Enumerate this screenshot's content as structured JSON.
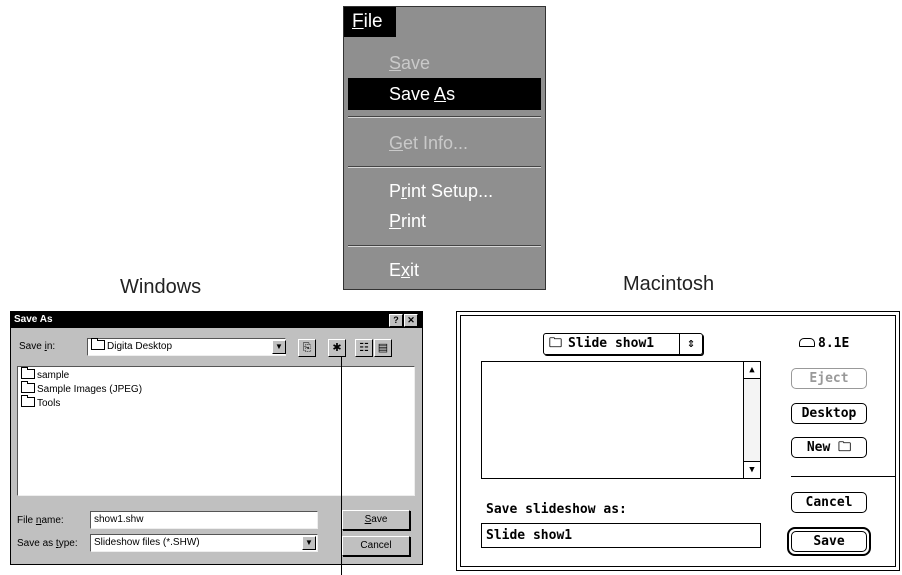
{
  "menu": {
    "title_key": "F",
    "title_rest": "ile",
    "items": [
      {
        "pre": "",
        "key": "S",
        "post": "ave",
        "disabled": true
      },
      {
        "pre": "Save ",
        "key": "A",
        "post": "s",
        "selected": true
      },
      {
        "pre": "",
        "key": "G",
        "post": "et Info...",
        "disabled": true
      },
      {
        "pre": "P",
        "key": "r",
        "post": "int Setup..."
      },
      {
        "pre": "",
        "key": "P",
        "post": "rint"
      },
      {
        "pre": "E",
        "key": "x",
        "post": "it"
      }
    ]
  },
  "captions": {
    "windows": "Windows",
    "macintosh": "Macintosh"
  },
  "windows_dialog": {
    "title": "Save As",
    "help_btn": "?",
    "close_btn": "✕",
    "save_in_pre": "Save ",
    "save_in_key": "i",
    "save_in_post": "n:",
    "save_in_value": "Digita Desktop",
    "files": [
      "sample",
      "Sample Images (JPEG)",
      "Tools"
    ],
    "file_name_pre": "File ",
    "file_name_key": "n",
    "file_name_post": "ame:",
    "file_name_value": "show1.shw",
    "type_pre": "Save as ",
    "type_key": "t",
    "type_post": "ype:",
    "type_value": "Slideshow files (*.SHW)",
    "save_key": "S",
    "save_post": "ave",
    "cancel": "Cancel"
  },
  "mac_dialog": {
    "folder_popup": "Slide show1",
    "disk_name": "8.1E",
    "eject": "Eject",
    "desktop": "Desktop",
    "new": "New",
    "cancel": "Cancel",
    "save": "Save",
    "prompt": "Save slideshow as:",
    "filename": "Slide show1"
  },
  "colors": {
    "menu_bg": "#8f8f8f",
    "win_face": "#c0c0c0",
    "selection": "#000000"
  }
}
